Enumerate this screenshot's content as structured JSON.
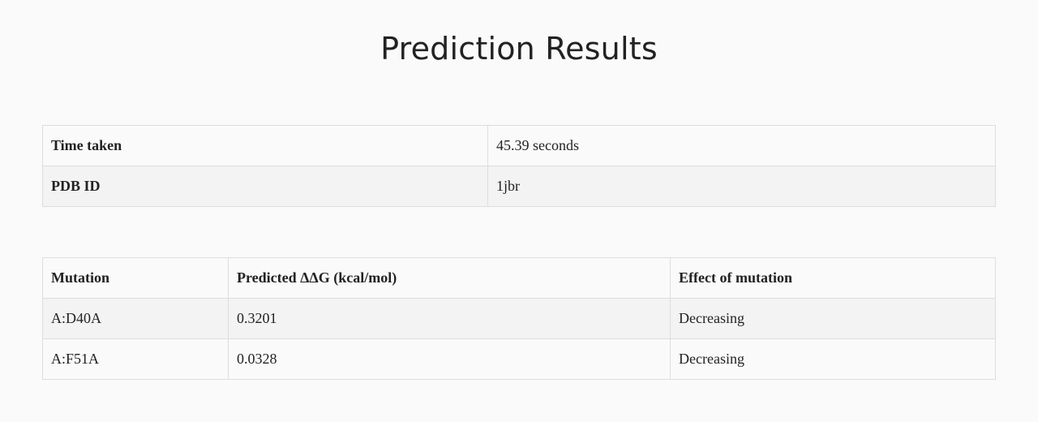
{
  "page": {
    "title": "Prediction Results"
  },
  "info": {
    "rows": [
      {
        "label": "Time taken",
        "value": "45.39 seconds"
      },
      {
        "label": "PDB ID",
        "value": "1jbr"
      }
    ]
  },
  "results": {
    "headers": [
      "Mutation",
      "Predicted ΔΔG (kcal/mol)",
      "Effect of mutation"
    ],
    "rows": [
      {
        "mutation": "A:D40A",
        "ddg": "0.3201",
        "effect": "Decreasing"
      },
      {
        "mutation": "A:F51A",
        "ddg": "0.0328",
        "effect": "Decreasing"
      }
    ]
  }
}
